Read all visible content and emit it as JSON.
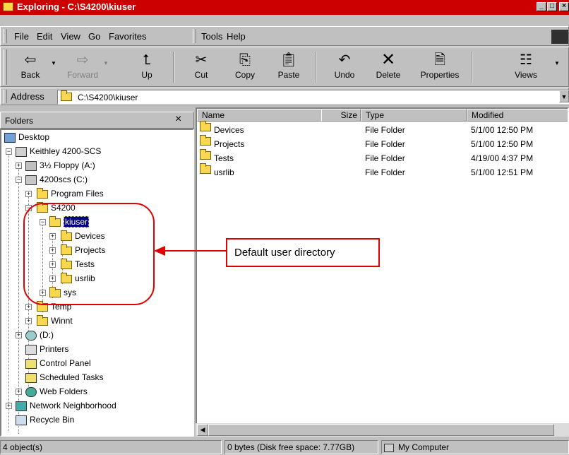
{
  "window": {
    "title": "Exploring - C:\\S4200\\kiuser"
  },
  "menu": [
    {
      "label": "File",
      "key": "F"
    },
    {
      "label": "Edit",
      "key": "E"
    },
    {
      "label": "View",
      "key": "V"
    },
    {
      "label": "Go",
      "key": "G"
    },
    {
      "label": "Favorites",
      "key": "a"
    },
    {
      "label": "Tools",
      "key": "T"
    },
    {
      "label": "Help",
      "key": "H"
    }
  ],
  "toolbar": {
    "back": "Back",
    "forward": "Forward",
    "up": "Up",
    "cut": "Cut",
    "copy": "Copy",
    "paste": "Paste",
    "undo": "Undo",
    "delete": "Delete",
    "properties": "Properties",
    "views": "Views"
  },
  "address": {
    "label": "Address",
    "value": "C:\\S4200\\kiuser"
  },
  "folders_pane": {
    "title": "Folders",
    "close": "×"
  },
  "tree": {
    "desktop": "Desktop",
    "computer": "Keithley 4200-SCS",
    "floppy": "3½ Floppy (A:)",
    "cdrive": "4200scs (C:)",
    "program_files": "Program Files",
    "s4200": "S4200",
    "kiuser": "kiuser",
    "devices": "Devices",
    "projects": "Projects",
    "tests": "Tests",
    "usrlib": "usrlib",
    "sys": "sys",
    "temp": "Temp",
    "winnt": "Winnt",
    "ddrive": "(D:)",
    "printers": "Printers",
    "control_panel": "Control Panel",
    "scheduled_tasks": "Scheduled Tasks",
    "web_folders": "Web Folders",
    "network": "Network Neighborhood",
    "recycle": "Recycle Bin"
  },
  "list": {
    "headers": {
      "name": "Name",
      "size": "Size",
      "type": "Type",
      "modified": "Modified"
    },
    "rows": [
      {
        "name": "Devices",
        "type": "File Folder",
        "modified": "5/1/00 12:50 PM"
      },
      {
        "name": "Projects",
        "type": "File Folder",
        "modified": "5/1/00 12:50 PM"
      },
      {
        "name": "Tests",
        "type": "File Folder",
        "modified": "4/19/00 4:37 PM"
      },
      {
        "name": "usrlib",
        "type": "File Folder",
        "modified": "5/1/00 12:51 PM"
      }
    ]
  },
  "annotation": {
    "label": "Default user directory"
  },
  "status": {
    "objects": "4 object(s)",
    "space": "0 bytes (Disk free space: 7.77GB)",
    "location": "My Computer"
  },
  "colors": {
    "title_bar": "#cc0000",
    "annotation": "#e00000",
    "selection": "#000080"
  }
}
